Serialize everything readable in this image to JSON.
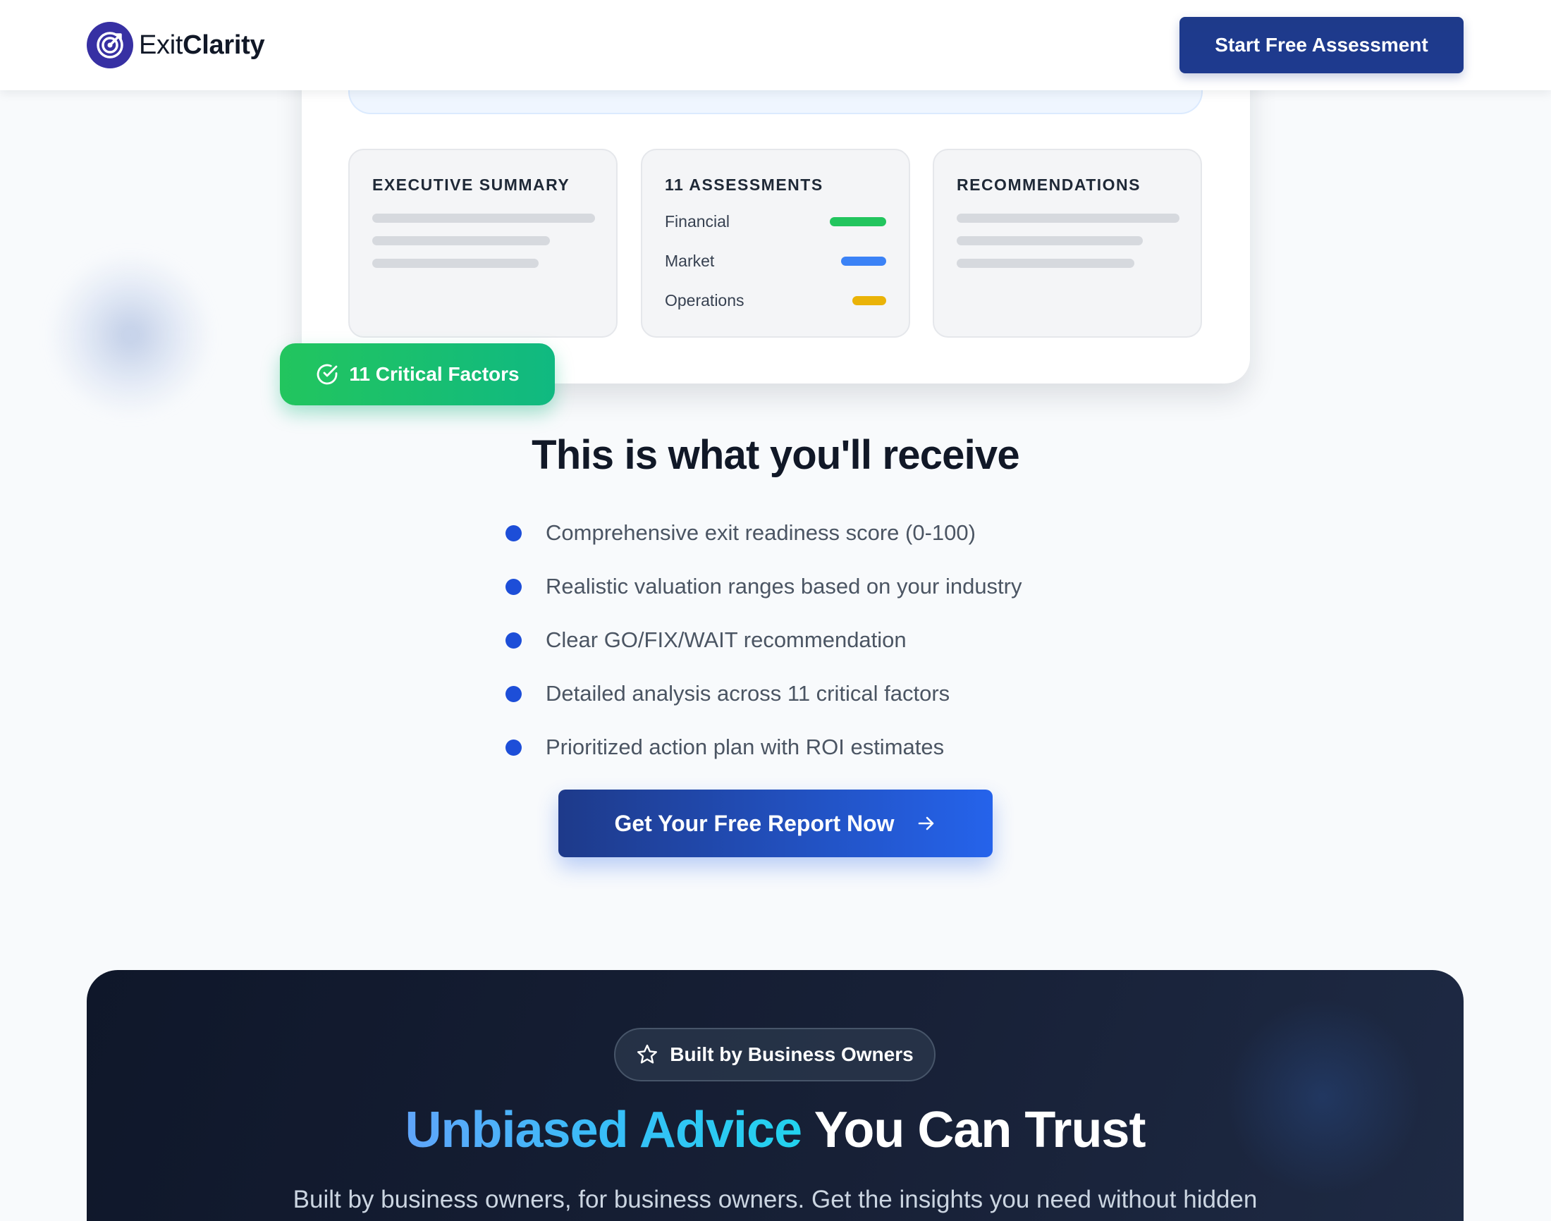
{
  "header": {
    "logo_light": "Exit",
    "logo_bold": "Clarity",
    "logo_icon": "target-icon",
    "cta_label": "Start Free Assessment"
  },
  "report_preview": {
    "panels": {
      "summary": {
        "title": "EXECUTIVE SUMMARY"
      },
      "assessments": {
        "title": "11 ASSESSMENTS",
        "items": [
          {
            "label": "Financial",
            "color": "#22c55e"
          },
          {
            "label": "Market",
            "color": "#3b82f6"
          },
          {
            "label": "Operations",
            "color": "#eab308"
          }
        ]
      },
      "recommendations": {
        "title": "RECOMMENDATIONS"
      }
    },
    "badge_label": "11 Critical Factors",
    "badge_icon": "check-circle-icon"
  },
  "receive": {
    "title": "This is what you'll receive",
    "benefits": [
      "Comprehensive exit readiness score (0-100)",
      "Realistic valuation ranges based on your industry",
      "Clear GO/FIX/WAIT recommendation",
      "Detailed analysis across 11 critical factors",
      "Prioritized action plan with ROI estimates"
    ],
    "cta_label": "Get Your Free Report Now",
    "cta_icon": "arrow-right-icon"
  },
  "trust": {
    "pill_label": "Built by Business Owners",
    "pill_icon": "star-icon",
    "title_highlight": "Unbiased Advice",
    "title_rest": " You Can Trust",
    "subtitle": "Built by business owners, for business owners. Get the insights you need without hidden"
  },
  "colors": {
    "brand": "#1e3a8a",
    "accent": "#2563eb",
    "success": "#10b981"
  }
}
